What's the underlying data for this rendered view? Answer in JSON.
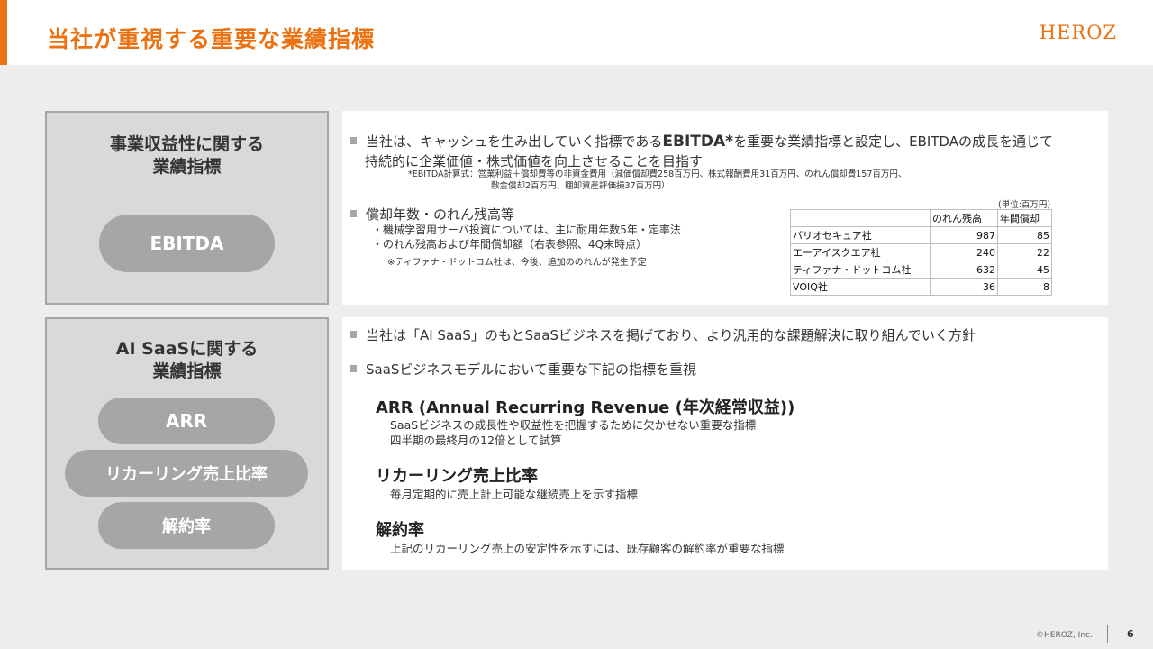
{
  "header": {
    "title": "当社が重視する重要な業績指標",
    "logo": "HEROZ"
  },
  "colors": {
    "accent": "#ec7211",
    "box": "#d9d9d9",
    "pill": "#a6a6a6"
  },
  "left_top": {
    "title_line1": "事業収益性に関する",
    "title_line2": "業績指標",
    "pill": "EBITDA"
  },
  "left_bottom": {
    "title_line1": "AI SaaSに関する",
    "title_line2": "業績指標",
    "pills": [
      "ARR",
      "リカーリング売上比率",
      "解約率"
    ]
  },
  "ebitda": {
    "bullet_pre": "当社は、キャッシュを生み出していく指標である",
    "bullet_bold": "EBITDA*",
    "bullet_post": "を重要な業績指標と設定し、EBITDAの成長を通じて",
    "bullet_line2": "持続的に企業価値・株式価値を向上させることを目指す",
    "note1": "*EBITDA計算式：営業利益＋償却費等の非資金費用（減価償却費258百万円、株式報酬費用31百万円、のれん償却費157百万円、",
    "note2": "敷金償却2百万円、棚卸資産評価損37百万円）"
  },
  "amortization": {
    "bullet": "償却年数・のれん残高等",
    "sub1": "・機械学習用サーバ投資については、主に耐用年数5年・定率法",
    "sub2": "・のれん残高および年間償却額（右表参照、4Q末時点）",
    "sub3": "※ティファナ・ドットコム社は、今後、追加ののれんが発生予定"
  },
  "table": {
    "unit": "(単位:百万円)",
    "headers": [
      "",
      "のれん残高",
      "年間償却"
    ],
    "rows": [
      [
        "バリオセキュア社",
        "987",
        "85"
      ],
      [
        "エーアイスクエア社",
        "240",
        "22"
      ],
      [
        "ティファナ・ドットコム社",
        "632",
        "45"
      ],
      [
        "VOIQ社",
        "36",
        "8"
      ]
    ]
  },
  "saas": {
    "bullet1": "当社は「AI SaaS」のもとSaaSビジネスを掲げており、より汎用的な課題解決に取り組んでいく方針",
    "bullet2": "SaaSビジネスモデルにおいて重要な下記の指標を重視",
    "metrics": [
      {
        "heading": "ARR (Annual Recurring Revenue (年次経常収益))",
        "desc1": "SaaSビジネスの成長性や収益性を把握するために欠かせない重要な指標",
        "desc2": "四半期の最終月の12倍として試算"
      },
      {
        "heading": "リカーリング売上比率",
        "desc1": "毎月定期的に売上計上可能な継続売上を示す指標"
      },
      {
        "heading": "解約率",
        "desc1": "上記のリカーリング売上の安定性を示すには、既存顧客の解約率が重要な指標"
      }
    ]
  },
  "footer": {
    "copyright": "©HEROZ, Inc.",
    "page": "6"
  }
}
